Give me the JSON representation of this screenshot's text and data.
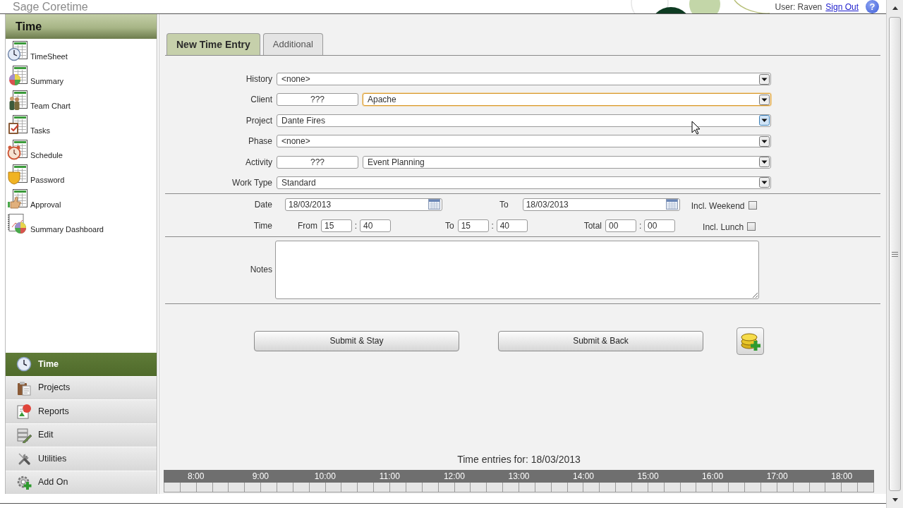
{
  "header": {
    "title": "Sage Coretime",
    "user": "User: Raven",
    "sign_out": "Sign Out",
    "help": "?"
  },
  "sidebar": {
    "title": "Time",
    "items": [
      {
        "label": "TimeSheet"
      },
      {
        "label": "Summary"
      },
      {
        "label": "Team Chart"
      },
      {
        "label": "Tasks"
      },
      {
        "label": "Schedule"
      },
      {
        "label": "Password"
      },
      {
        "label": "Approval"
      },
      {
        "label": "Summary Dashboard"
      }
    ]
  },
  "nav": [
    {
      "label": "Time",
      "selected": true
    },
    {
      "label": "Projects",
      "selected": false
    },
    {
      "label": "Reports",
      "selected": false
    },
    {
      "label": "Edit",
      "selected": false
    },
    {
      "label": "Utilities",
      "selected": false
    },
    {
      "label": "Add On",
      "selected": false
    }
  ],
  "tabs": [
    {
      "label": "New Time Entry",
      "selected": true
    },
    {
      "label": "Additional",
      "selected": false
    }
  ],
  "form": {
    "fields": [
      {
        "label": "History",
        "value": "<none>",
        "focused": false,
        "hovered": false
      },
      {
        "label": "Client",
        "code": "???",
        "value": "Apache",
        "focused": true,
        "hovered": false
      },
      {
        "label": "Project",
        "value": "Dante Fires",
        "focused": false,
        "hovered": true
      },
      {
        "label": "Phase",
        "value": "<none>",
        "focused": false,
        "hovered": false
      },
      {
        "label": "Activity",
        "code": "???",
        "value": "Event Planning",
        "focused": false,
        "hovered": false
      },
      {
        "label": "Work Type",
        "value": "Standard",
        "focused": false,
        "hovered": false
      }
    ],
    "date": {
      "label": "Date",
      "from": "18/03/2013",
      "to_label": "To",
      "to": "18/03/2013",
      "option": {
        "label": "Incl. Weekend",
        "checked": false
      }
    },
    "time": {
      "label": "Time",
      "parts": [
        {
          "label": "From",
          "hours": "15",
          "separator": ":",
          "minutes": "40"
        },
        {
          "label": "To",
          "hours": "15",
          "separator": ":",
          "minutes": "40"
        },
        {
          "label": "Total",
          "hours": "00",
          "separator": ":",
          "minutes": "00"
        }
      ],
      "option": {
        "label": "Incl. Lunch",
        "checked": false
      }
    },
    "notes": {
      "label": "Notes"
    },
    "buttons": [
      {
        "label": "Submit & Stay"
      },
      {
        "label": "Submit & Back"
      }
    ]
  },
  "timeline": {
    "title": "Time entries for: 18/03/2013",
    "hours": [
      "8:00",
      "9:00",
      "10:00",
      "11:00",
      "12:00",
      "13:00",
      "14:00",
      "15:00",
      "16:00",
      "17:00",
      "18:00"
    ]
  }
}
